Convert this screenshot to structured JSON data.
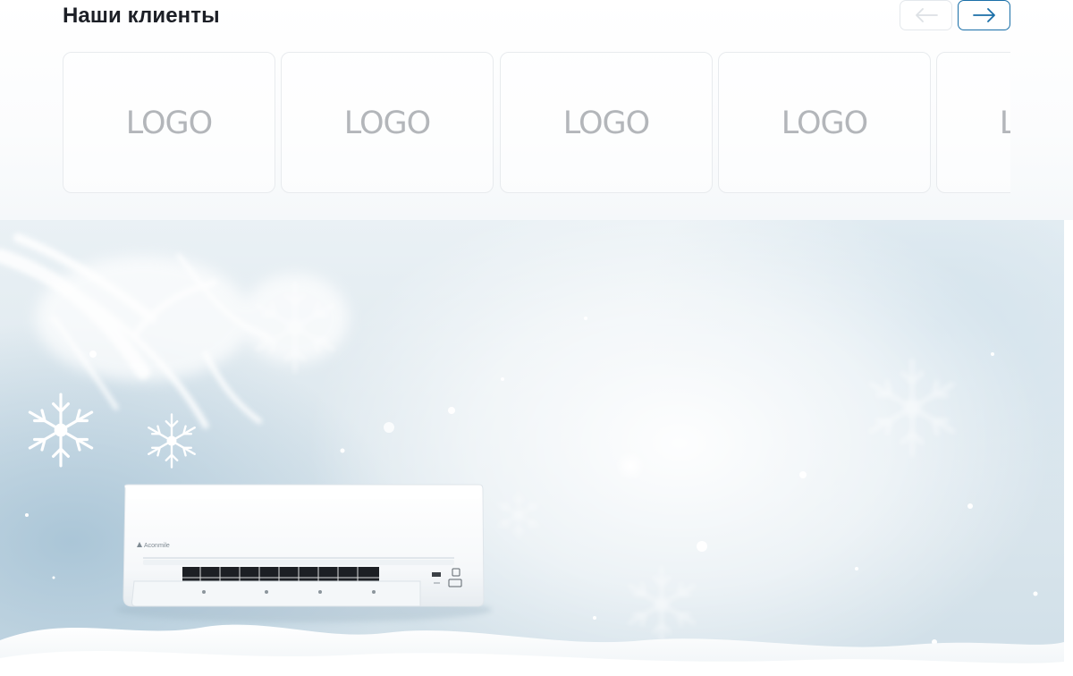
{
  "clients": {
    "title": "Наши клиенты",
    "prev_icon": "arrow-left-icon",
    "next_icon": "arrow-right-icon",
    "accent_color": "#1a6fa8",
    "logos": [
      {
        "label": "LOGO"
      },
      {
        "label": "LOGO"
      },
      {
        "label": "LOGO"
      },
      {
        "label": "LOGO"
      },
      {
        "label": "LOGO"
      }
    ]
  },
  "banner": {
    "theme": "winter",
    "product_brand": "Aconmile"
  }
}
